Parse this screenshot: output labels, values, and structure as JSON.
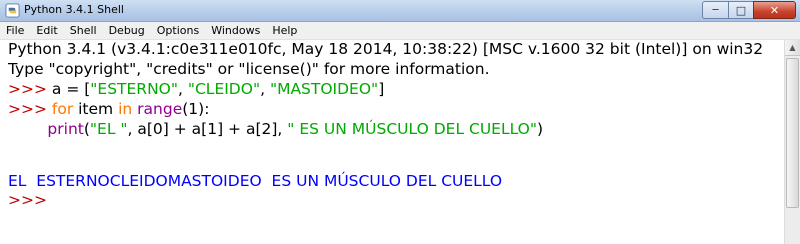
{
  "window": {
    "title": "Python 3.4.1 Shell",
    "controls": {
      "minimize": "─",
      "maximize": "□",
      "close": "✕"
    }
  },
  "menu": [
    "File",
    "Edit",
    "Shell",
    "Debug",
    "Options",
    "Windows",
    "Help"
  ],
  "colors": {
    "prompt": "#c00000",
    "string": "#00aa00",
    "keyword": "#ff7700",
    "builtin": "#900090",
    "output": "#0000ff"
  },
  "shell": {
    "banner1": "Python 3.4.1 (v3.4.1:c0e311e010fc, May 18 2014, 10:38:22) [MSC v.1600 32 bit (Intel)] on win32",
    "banner2": "Type \"copyright\", \"credits\" or \"license()\" for more information.",
    "prompt": ">>> ",
    "line1": {
      "code_pre": "a = [",
      "s1": "\"ESTERNO\"",
      "sep1": ", ",
      "s2": "\"CLEIDO\"",
      "sep2": ", ",
      "s3": "\"MASTOIDEO\"",
      "code_post": "]"
    },
    "line2": {
      "kw_for": "for",
      "mid": " item ",
      "kw_in": "in",
      "sp": " ",
      "builtin": "range",
      "rest": "(1):"
    },
    "line3": {
      "indent": "        ",
      "builtin": "print",
      "open": "(",
      "s1": "\"EL \"",
      "middle": ", a[0] + a[1] + a[2], ",
      "s2": "\" ES UN MÚSCULO DEL CUELLO\"",
      "close": ")"
    },
    "output": "EL  ESTERNOCLEIDOMASTOIDEO  ES UN MÚSCULO DEL CUELLO",
    "final_prompt": ">>> "
  }
}
